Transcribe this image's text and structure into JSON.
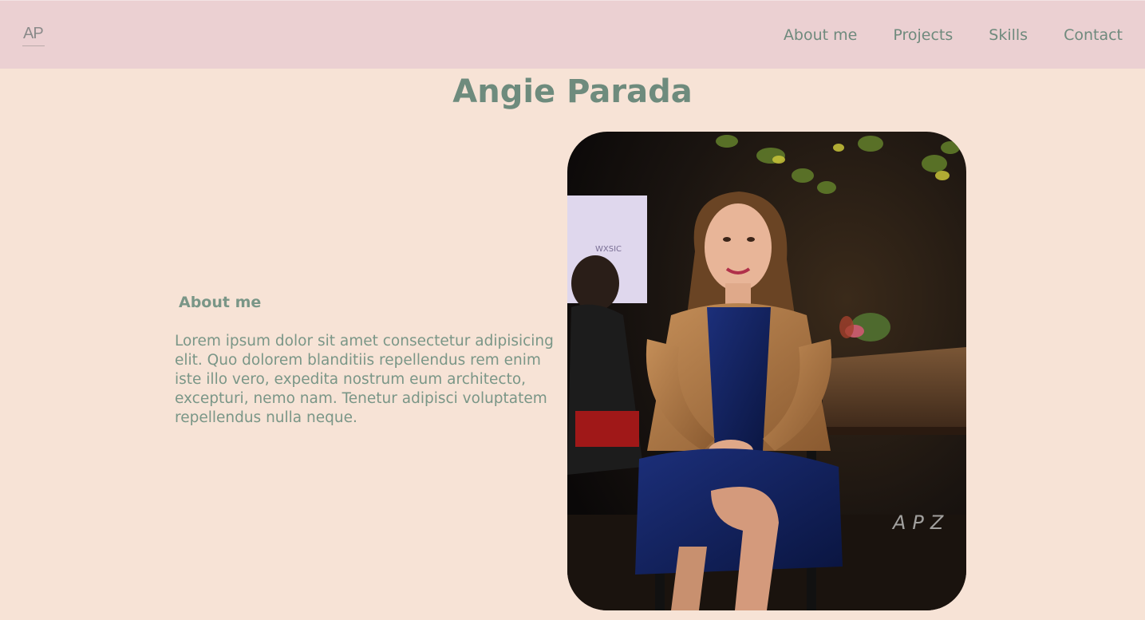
{
  "logo": {
    "text": "AP"
  },
  "nav": {
    "items": [
      {
        "label": "About me"
      },
      {
        "label": "Projects"
      },
      {
        "label": "Skills"
      },
      {
        "label": "Contact"
      }
    ]
  },
  "hero": {
    "title": "Angie Parada"
  },
  "about": {
    "heading": "About me",
    "body": "Lorem ipsum dolor sit amet consectetur adipisicing elit. Quo dolorem blanditiis repellendus rem enim iste illo vero, expedita nostrum eum architecto, excepturi, nemo nam. Tenetur adipisci voluptatem repellendus nulla neque."
  },
  "photo": {
    "watermark": "APZ"
  },
  "colors": {
    "background": "#f7e3d6",
    "header": "#ebd0d2",
    "accent": "#6e8b7d"
  }
}
